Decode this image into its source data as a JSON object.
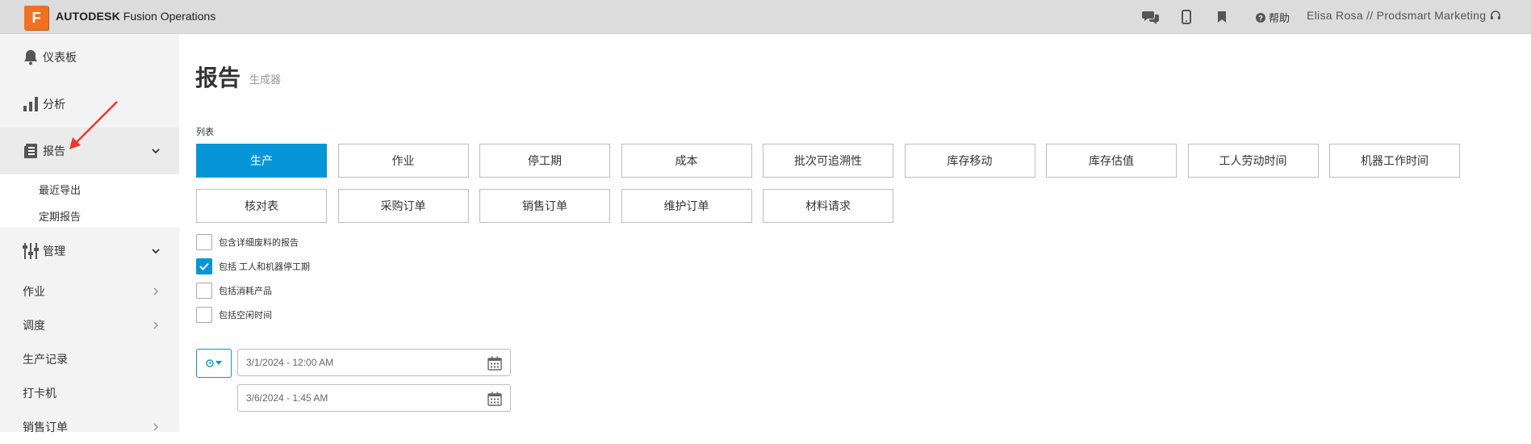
{
  "app": {
    "logo_letter": "F",
    "brand_bold": "AUTODESK",
    "brand_rest": " Fusion Operations"
  },
  "topbar": {
    "help_label": "帮助",
    "user_label": "Elisa Rosa // Prodsmart Marketing"
  },
  "sidebar": {
    "dashboard": "仪表板",
    "analytics": "分析",
    "reports": "报告",
    "reports_sub": [
      "最近导出",
      "定期报告"
    ],
    "manage": "管理",
    "jobs": "作业",
    "scheduling": "调度",
    "production_records": "生产记录",
    "time_clock": "打卡机",
    "sales_orders": "销售订单"
  },
  "page": {
    "title": "报告",
    "subtitle": "生成器",
    "list_label": "列表"
  },
  "report_types": [
    "生产",
    "作业",
    "停工期",
    "成本",
    "批次可追溯性",
    "库存移动",
    "库存估值",
    "工人劳动时间",
    "机器工作时间",
    "核对表",
    "采购订单",
    "销售订单",
    "维护订单",
    "材料请求"
  ],
  "active_report": "生产",
  "options": [
    {
      "label": "包含详细废料的报告",
      "checked": false
    },
    {
      "label": "包括 工人和机器停工期",
      "checked": true
    },
    {
      "label": "包括消耗产品",
      "checked": false
    },
    {
      "label": "包括空闲时间",
      "checked": false
    }
  ],
  "date_range": {
    "start": "3/1/2024 - 12:00 AM",
    "end": "3/6/2024 - 1:45 AM"
  },
  "colors": {
    "accent": "#0696d7",
    "brand": "#f37021",
    "annotation_arrow": "#e53935"
  }
}
